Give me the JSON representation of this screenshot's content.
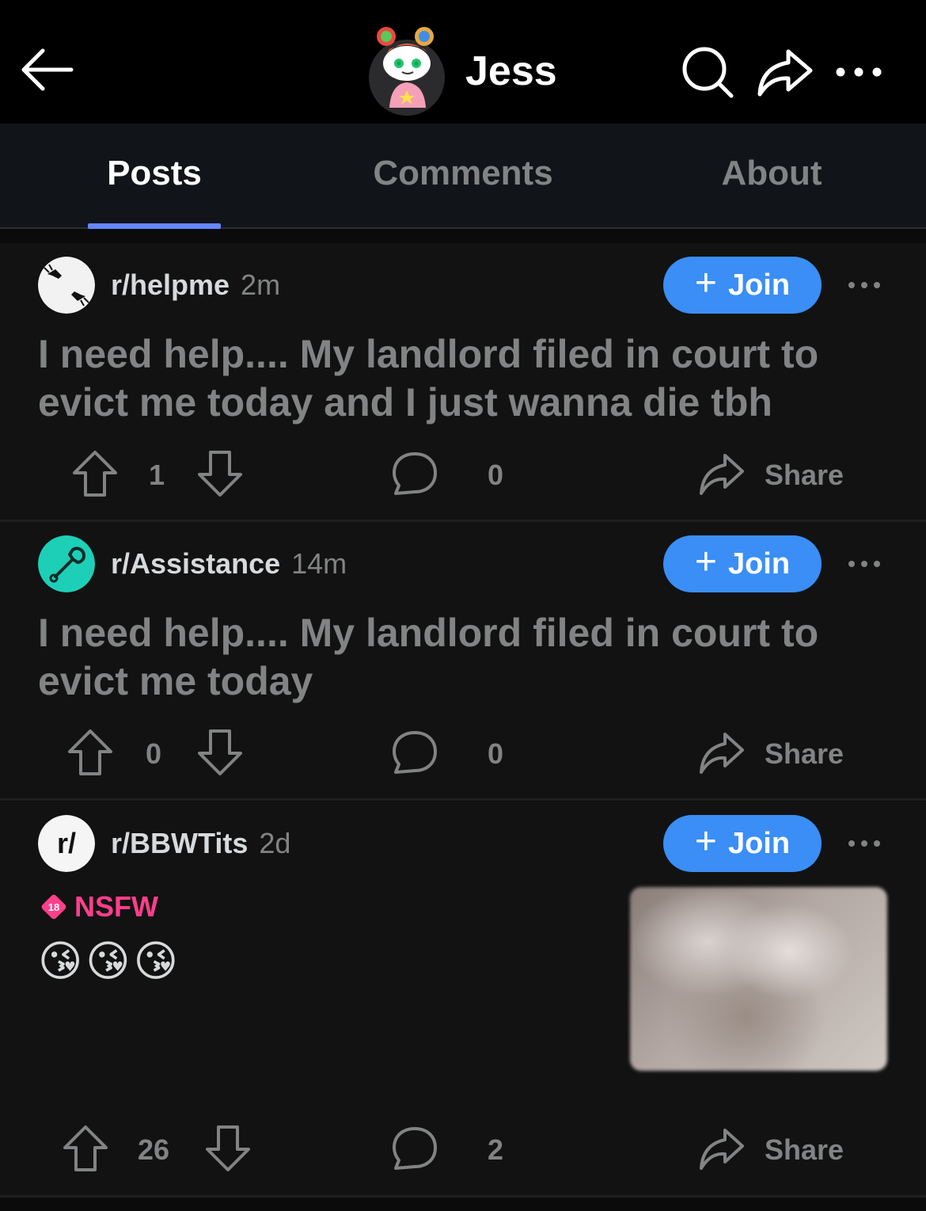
{
  "header": {
    "username": "Jess",
    "icons": [
      "back-arrow-icon",
      "avatar",
      "search-icon",
      "share-icon",
      "more-icon"
    ]
  },
  "tabs": [
    {
      "label": "Posts",
      "active": true
    },
    {
      "label": "Comments",
      "active": false
    },
    {
      "label": "About",
      "active": false
    }
  ],
  "posts": [
    {
      "subreddit": "r/helpme",
      "time": "2m",
      "join_label": "Join",
      "title": "I need help.... My landlord filed in court to evict me today and I just wanna die tbh",
      "votes": "1",
      "comments": "0",
      "share_label": "Share"
    },
    {
      "subreddit": "r/Assistance",
      "time": "14m",
      "join_label": "Join",
      "title": "I need help.... My landlord filed in court to evict me today",
      "votes": "0",
      "comments": "0",
      "share_label": "Share"
    },
    {
      "subreddit": "r/BBWTits",
      "time": "2d",
      "join_label": "Join",
      "nsfw_badge": "18",
      "nsfw_label": "NSFW",
      "body": "😘😘😘",
      "votes": "26",
      "comments": "2",
      "share_label": "Share"
    }
  ],
  "colors": {
    "accent_join": "#3a8ef5",
    "tab_indicator": "#6586ff",
    "nsfw": "#ff3f8a"
  }
}
